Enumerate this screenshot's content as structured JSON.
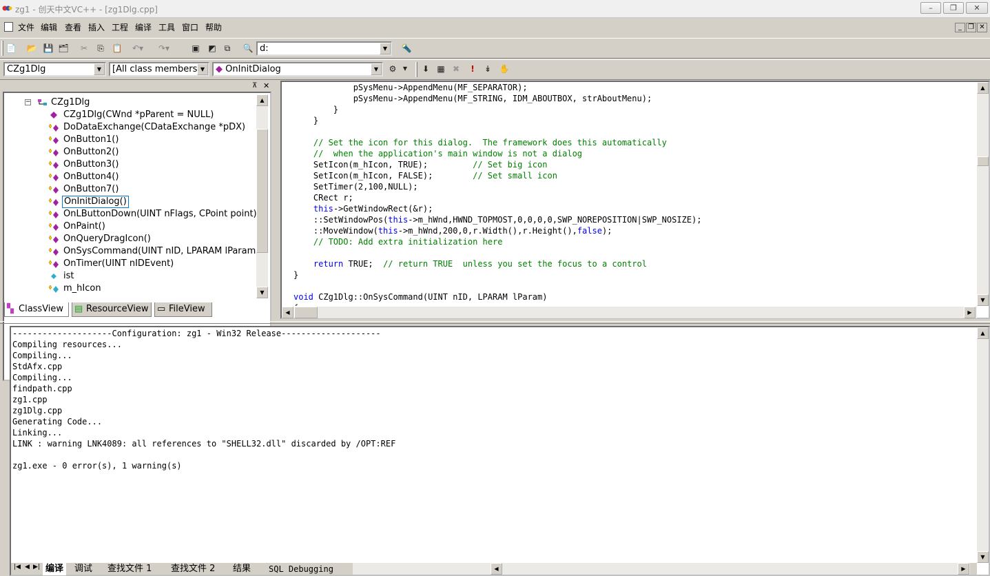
{
  "window": {
    "title": "zg1 - 创天中文VC++ - [zg1Dlg.cpp]",
    "min": "–",
    "max": "❐",
    "close": "✕"
  },
  "menu": [
    "文件",
    "编辑",
    "查看",
    "插入",
    "工程",
    "编译",
    "工具",
    "窗口",
    "帮助"
  ],
  "toolbar": {
    "path_combo": "d:"
  },
  "wizardbar": {
    "class_combo": "CZg1Dlg",
    "filter_combo": "[All class members]",
    "member_combo": "OnInitDialog"
  },
  "classview": {
    "root": "CZg1Dlg",
    "items": [
      {
        "label": "CZg1Dlg(CWnd *pParent = NULL)",
        "kind": "ctor"
      },
      {
        "label": "DoDataExchange(CDataExchange *pDX)",
        "kind": "method"
      },
      {
        "label": "OnButton1()",
        "kind": "method"
      },
      {
        "label": "OnButton2()",
        "kind": "method"
      },
      {
        "label": "OnButton3()",
        "kind": "method"
      },
      {
        "label": "OnButton4()",
        "kind": "method"
      },
      {
        "label": "OnButton7()",
        "kind": "method"
      },
      {
        "label": "OnInitDialog()",
        "kind": "method",
        "selected": true
      },
      {
        "label": "OnLButtonDown(UINT nFlags, CPoint point)",
        "kind": "method"
      },
      {
        "label": "OnPaint()",
        "kind": "method"
      },
      {
        "label": "OnQueryDragIcon()",
        "kind": "method"
      },
      {
        "label": "OnSysCommand(UINT nID, LPARAM lParam)",
        "kind": "method"
      },
      {
        "label": "OnTimer(UINT nIDEvent)",
        "kind": "method"
      },
      {
        "label": "ist",
        "kind": "var"
      },
      {
        "label": "m_hIcon",
        "kind": "protvar"
      }
    ],
    "tabs": [
      "ClassView",
      "ResourceView",
      "FileView"
    ]
  },
  "editor": {
    "lines": [
      "            pSysMenu->AppendMenu(MF_SEPARATOR);",
      "            pSysMenu->AppendMenu(MF_STRING, IDM_ABOUTBOX, strAboutMenu);",
      "        }",
      "    }",
      "",
      "    // Set the icon for this dialog.  The framework does this automatically",
      "    //  when the application's main window is not a dialog",
      "    SetIcon(m_hIcon, TRUE);         // Set big icon",
      "    SetIcon(m_hIcon, FALSE);        // Set small icon",
      "    SetTimer(2,100,NULL);",
      "    CRect r;",
      "    this->GetWindowRect(&r);",
      "    ::SetWindowPos(this->m_hWnd,HWND_TOPMOST,0,0,0,0,SWP_NOREPOSITION|SWP_NOSIZE);",
      "    ::MoveWindow(this->m_hWnd,200,0,r.Width(),r.Height(),false);",
      "    // TODO: Add extra initialization here",
      "",
      "    return TRUE;  // return TRUE  unless you set the focus to a control",
      "}",
      "",
      "void CZg1Dlg::OnSysCommand(UINT nID, LPARAM lParam)",
      "{"
    ]
  },
  "output": {
    "lines": [
      "--------------------Configuration: zg1 - Win32 Release--------------------",
      "Compiling resources...",
      "Compiling...",
      "StdAfx.cpp",
      "Compiling...",
      "findpath.cpp",
      "zg1.cpp",
      "zg1Dlg.cpp",
      "Generating Code...",
      "Linking...",
      "LINK : warning LNK4089: all references to \"SHELL32.dll\" discarded by /OPT:REF",
      "",
      "zg1.exe - 0 error(s), 1 warning(s)"
    ],
    "tabs": [
      "编译",
      "调试",
      "查找文件 1",
      "查找文件 2",
      "结果",
      "SQL Debugging"
    ]
  },
  "colors": {
    "keyword": "#0000ff",
    "comment": "#008000",
    "method_icon": "#a020a0",
    "selection_border": "#0078d7"
  }
}
